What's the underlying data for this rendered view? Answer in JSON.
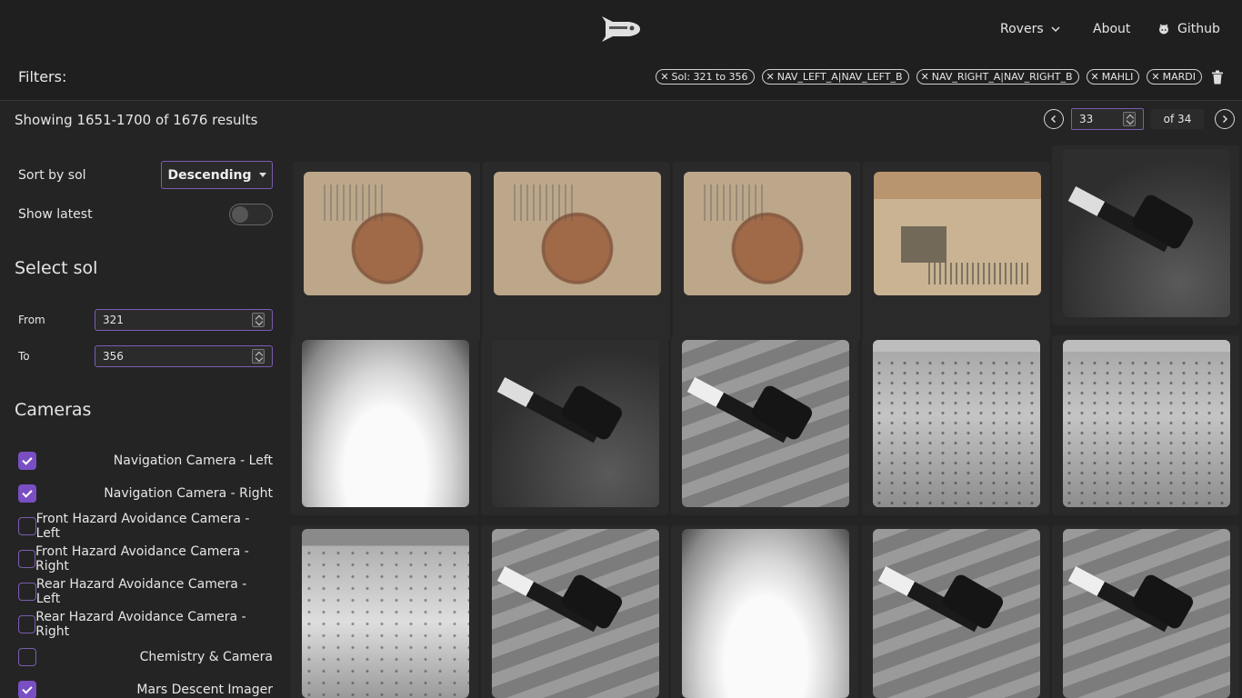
{
  "nav": {
    "logo_icon": "rocket-icon",
    "items": [
      {
        "label": "Rovers",
        "icon": "chevron-down-icon"
      },
      {
        "label": "About"
      },
      {
        "label": "Github",
        "icon": "github-icon"
      }
    ]
  },
  "filters": {
    "label": "Filters:",
    "chips": [
      "Sol: 321 to 356",
      "NAV_LEFT_A|NAV_LEFT_B",
      "NAV_RIGHT_A|NAV_RIGHT_B",
      "MAHLI",
      "MARDI"
    ],
    "clear_icon": "trash-icon"
  },
  "results": {
    "summary": "Showing 1651-1700 of 1676 results"
  },
  "pager": {
    "current_page": "33",
    "of_label": "of 34"
  },
  "sidebar": {
    "sort_label": "Sort by sol",
    "sort_value": "Descending",
    "show_latest_label": "Show latest",
    "show_latest_on": false,
    "select_sol_title": "Select sol",
    "from_label": "From",
    "from_value": "321",
    "to_label": "To",
    "to_value": "356",
    "cameras_title": "Cameras",
    "cameras": [
      {
        "label": "Navigation Camera - Left",
        "checked": true
      },
      {
        "label": "Navigation Camera - Right",
        "checked": true
      },
      {
        "label": "Front Hazard Avoidance Camera - Left",
        "checked": false
      },
      {
        "label": "Front Hazard Avoidance Camera - Right",
        "checked": false
      },
      {
        "label": "Rear Hazard Avoidance Camera - Left",
        "checked": false
      },
      {
        "label": "Rear Hazard Avoidance Camera - Right",
        "checked": false
      },
      {
        "label": "Chemistry & Camera",
        "checked": false
      },
      {
        "label": "Mars Descent Imager",
        "checked": true
      }
    ]
  },
  "theme": {
    "accent": "#7a4fc4",
    "background": "#242424",
    "header": "#1f1f1f"
  }
}
